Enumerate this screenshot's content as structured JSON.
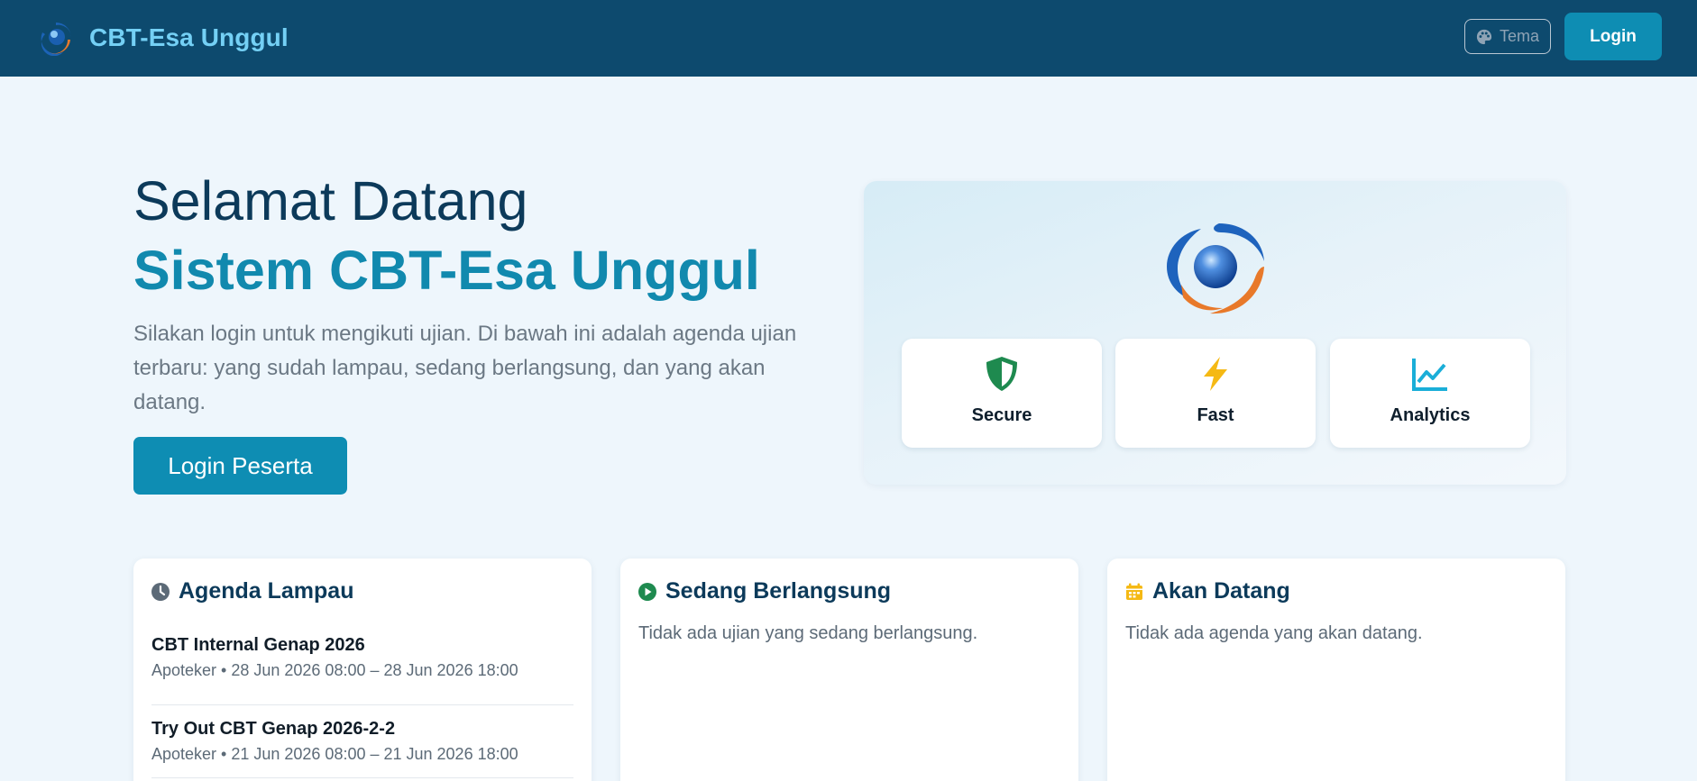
{
  "navbar": {
    "brand": "CBT-Esa Unggul",
    "brand_icon": "esa-unggul-logo-icon",
    "theme_label": "Tema",
    "theme_icon": "palette-icon",
    "login_label": "Login"
  },
  "hero": {
    "title_line1": "Selamat Datang",
    "title_line2": "Sistem CBT-Esa Unggul",
    "description": "Silakan login untuk mengikuti ujian. Di bawah ini adalah agenda ujian terbaru: yang sudah lampau, sedang berlangsung, dan yang akan datang.",
    "cta_label": "Login Peserta",
    "features": [
      {
        "label": "Secure",
        "icon": "shield-icon",
        "color": "#1e8a4f"
      },
      {
        "label": "Fast",
        "icon": "lightning-icon",
        "color": "#f5b914"
      },
      {
        "label": "Analytics",
        "icon": "chart-line-icon",
        "color": "#1aaed8"
      }
    ]
  },
  "panels": {
    "past": {
      "title": "Agenda Lampau",
      "icon": "clock-icon",
      "items": [
        {
          "name": "CBT Internal Genap 2026",
          "meta": "Apoteker • 28 Jun 2026 08:00 – 28 Jun 2026 18:00"
        },
        {
          "name": "Try Out CBT Genap 2026-2-2",
          "meta": "Apoteker • 21 Jun 2026 08:00 – 21 Jun 2026 18:00"
        }
      ]
    },
    "ongoing": {
      "title": "Sedang Berlangsung",
      "icon": "play-circle-icon",
      "empty_text": "Tidak ada ujian yang sedang berlangsung."
    },
    "upcoming": {
      "title": "Akan Datang",
      "icon": "calendar-icon",
      "empty_text": "Tidak ada agenda yang akan datang."
    }
  },
  "colors": {
    "navbar_bg": "#0d4a6e",
    "brand_text": "#74d0f5",
    "accent": "#0e8db3",
    "page_bg": "#eef6fc"
  }
}
